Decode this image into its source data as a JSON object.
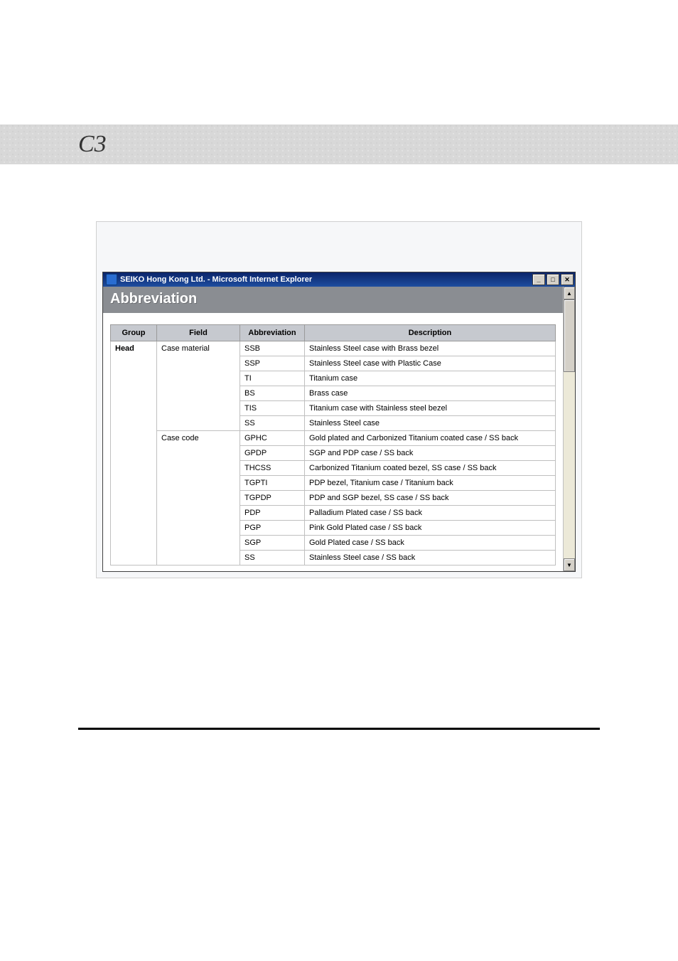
{
  "header": {
    "glyph": "C3"
  },
  "titlebar": {
    "text": "SEIKO Hong Kong Ltd. - Microsoft Internet Explorer",
    "min": "_",
    "max": "□",
    "close": "✕"
  },
  "page": {
    "title": "Abbreviation"
  },
  "table": {
    "headers": {
      "group": "Group",
      "field": "Field",
      "abbr": "Abbreviation",
      "desc": "Description"
    },
    "rows": [
      {
        "group": "Head",
        "field": "Case material",
        "abbr": "SSB",
        "desc": "Stainless Steel case with Brass bezel"
      },
      {
        "group": "",
        "field": "",
        "abbr": "SSP",
        "desc": "Stainless Steel case with Plastic Case"
      },
      {
        "group": "",
        "field": "",
        "abbr": "TI",
        "desc": "Titanium case"
      },
      {
        "group": "",
        "field": "",
        "abbr": "BS",
        "desc": "Brass case"
      },
      {
        "group": "",
        "field": "",
        "abbr": "TIS",
        "desc": "Titanium case with Stainless steel bezel"
      },
      {
        "group": "",
        "field": "",
        "abbr": "SS",
        "desc": "Stainless Steel case"
      },
      {
        "group": "",
        "field": "Case code",
        "abbr": "GPHC",
        "desc": "Gold plated and Carbonized Titanium coated case / SS back"
      },
      {
        "group": "",
        "field": "",
        "abbr": "GPDP",
        "desc": "SGP and PDP case / SS back"
      },
      {
        "group": "",
        "field": "",
        "abbr": "THCSS",
        "desc": "Carbonized Titanium coated bezel, SS case / SS back"
      },
      {
        "group": "",
        "field": "",
        "abbr": "TGPTI",
        "desc": "PDP bezel, Titanium case / Titanium back"
      },
      {
        "group": "",
        "field": "",
        "abbr": "TGPDP",
        "desc": "PDP and SGP bezel, SS case / SS back"
      },
      {
        "group": "",
        "field": "",
        "abbr": "PDP",
        "desc": "Palladium Plated case / SS back"
      },
      {
        "group": "",
        "field": "",
        "abbr": "PGP",
        "desc": "Pink Gold Plated case / SS back"
      },
      {
        "group": "",
        "field": "",
        "abbr": "SGP",
        "desc": "Gold Plated case / SS back"
      },
      {
        "group": "",
        "field": "",
        "abbr": "SS",
        "desc": "Stainless Steel case / SS back"
      }
    ]
  },
  "scrollbar": {
    "up": "▲",
    "down": "▼"
  }
}
